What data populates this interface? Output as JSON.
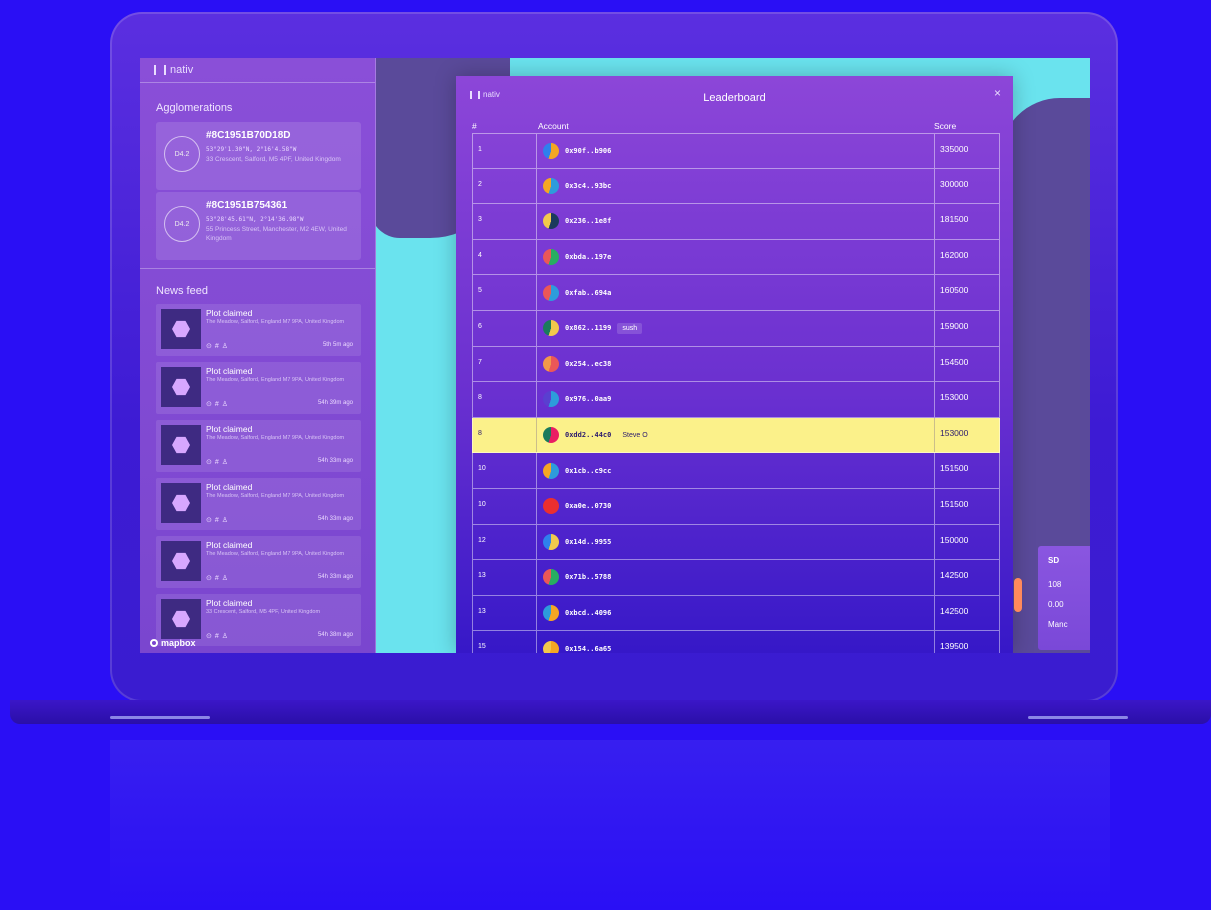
{
  "sidebar": {
    "brand": "nativ",
    "agglomerations_title": "Agglomerations",
    "agglomerations": [
      {
        "badge": "D4.2",
        "id": "#8C1951B70D18D",
        "coords": "53°29'1.30\"N, 2°16'4.58\"W",
        "address": "33 Crescent, Salford, M5 4PF, United Kingdom"
      },
      {
        "badge": "D4.2",
        "id": "#8C1951B754361",
        "coords": "53°28'45.61\"N, 2°14'36.98\"W",
        "address": "55 Princess Street, Manchester, M2 4EW, United Kingdom"
      }
    ],
    "news_title": "News feed",
    "news": [
      {
        "title": "Plot claimed",
        "address": "The Meadow, Salford, England M7 9PA, United Kingdom",
        "time": "5th 5m ago"
      },
      {
        "title": "Plot claimed",
        "address": "The Meadow, Salford, England M7 9PA, United Kingdom",
        "time": "54h 39m ago"
      },
      {
        "title": "Plot claimed",
        "address": "The Meadow, Salford, England M7 9PA, United Kingdom",
        "time": "54h 33m ago"
      },
      {
        "title": "Plot claimed",
        "address": "The Meadow, Salford, England M7 9PA, United Kingdom",
        "time": "54h 33m ago"
      },
      {
        "title": "Plot claimed",
        "address": "The Meadow, Salford, England M7 9PA, United Kingdom",
        "time": "54h 33m ago"
      },
      {
        "title": "Plot claimed",
        "address": "33 Crescent, Salford, M5 4PF, United Kingdom",
        "time": "54h 38m ago"
      }
    ],
    "mapbox": "mapbox"
  },
  "leaderboard": {
    "brand": "nativ",
    "title": "Leaderboard",
    "close": "×",
    "headers": {
      "rank": "#",
      "account": "Account",
      "score": "Score"
    },
    "rows": [
      {
        "rank": "1",
        "address": "0x90f..b906",
        "nick": "",
        "score": "335000",
        "colors": [
          "#f5a623",
          "#2f80ed"
        ]
      },
      {
        "rank": "2",
        "address": "0x3c4..93bc",
        "nick": "",
        "score": "300000",
        "colors": [
          "#2d9cdb",
          "#f5a623"
        ]
      },
      {
        "rank": "3",
        "address": "0x236..1e8f",
        "nick": "",
        "score": "181500",
        "colors": [
          "#1b3a5c",
          "#f2c94c"
        ]
      },
      {
        "rank": "4",
        "address": "0xbda..197e",
        "nick": "",
        "score": "162000",
        "colors": [
          "#27ae60",
          "#eb5757"
        ]
      },
      {
        "rank": "5",
        "address": "0xfab..694a",
        "nick": "",
        "score": "160500",
        "colors": [
          "#2d9cdb",
          "#eb5757"
        ]
      },
      {
        "rank": "6",
        "address": "0x862..1199",
        "nick": "sush",
        "score": "159000",
        "colors": [
          "#f2c94c",
          "#1a7a5c"
        ]
      },
      {
        "rank": "7",
        "address": "0x254..ec38",
        "nick": "",
        "score": "154500",
        "colors": [
          "#eb5757",
          "#f2994a"
        ]
      },
      {
        "rank": "8",
        "address": "0x976..0aa9",
        "nick": "",
        "score": "153000",
        "colors": [
          "#2d9cdb",
          "#5a3fd0"
        ]
      },
      {
        "rank": "8",
        "address": "0xdd2..44c0",
        "nick": "Steve O",
        "score": "153000",
        "colors": [
          "#e91e63",
          "#1a7a5c"
        ],
        "highlight": true
      },
      {
        "rank": "10",
        "address": "0x1cb..c9cc",
        "nick": "",
        "score": "151500",
        "colors": [
          "#2d9cdb",
          "#f5a623"
        ]
      },
      {
        "rank": "10",
        "address": "0xa0e..0730",
        "nick": "",
        "score": "151500",
        "colors": [
          "#eb2f2f",
          "#eb2f2f"
        ]
      },
      {
        "rank": "12",
        "address": "0x14d..9955",
        "nick": "",
        "score": "150000",
        "colors": [
          "#f2c94c",
          "#2f80ed"
        ]
      },
      {
        "rank": "13",
        "address": "0x71b..5788",
        "nick": "",
        "score": "142500",
        "colors": [
          "#27ae60",
          "#eb5757"
        ]
      },
      {
        "rank": "13",
        "address": "0xbcd..4096",
        "nick": "",
        "score": "142500",
        "colors": [
          "#f5a623",
          "#2d9cdb"
        ]
      },
      {
        "rank": "15",
        "address": "0x154..6a65",
        "nick": "",
        "score": "139500",
        "colors": [
          "#f5a623",
          "#f2c94c"
        ]
      }
    ]
  },
  "info_panel": {
    "code": "SD",
    "line1": "108",
    "line2": "0.00",
    "line3": "Manc"
  }
}
